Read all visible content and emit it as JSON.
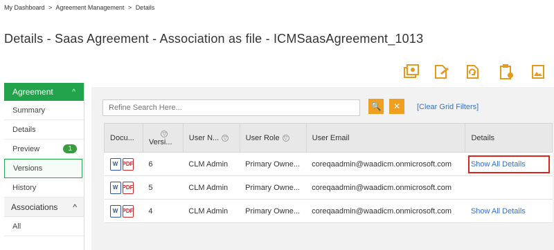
{
  "breadcrumb": [
    "My Dashboard",
    "Agreement Management",
    "Details"
  ],
  "breadcrumb_sep": ">",
  "page_title": "Details - Saas Agreement - Association as file - ICMSaasAgreement_1013",
  "toolbar": {
    "icons": [
      "agreement-copy-icon",
      "edit-document-icon",
      "refresh-document-icon",
      "clipboard-icon",
      "image-document-icon"
    ],
    "accent": "#f0a020"
  },
  "sidebar": {
    "header": "Agreement",
    "header_chevron": "^",
    "items": [
      {
        "label": "Summary"
      },
      {
        "label": "Details"
      },
      {
        "label": "Preview",
        "badge": "1"
      },
      {
        "label": "Versions",
        "selected": true
      },
      {
        "label": "History"
      }
    ],
    "group2": "Associations",
    "group2_chevron": "^",
    "group2_items": [
      {
        "label": "All"
      }
    ]
  },
  "search": {
    "placeholder": "Refine Search Here...",
    "search_icon": "🔍",
    "clear_icon": "✕",
    "clear_link": "[Clear Grid Filters]"
  },
  "grid": {
    "columns": [
      "Docu...",
      "Versi...",
      "User N...",
      "User Role",
      "User Email",
      "Details"
    ],
    "rows": [
      {
        "version": "6",
        "user": "CLM Admin",
        "role": "Primary Owne...",
        "email": "coreqaadmin@waadicm.onmicrosoft.com",
        "details": "Show All Details"
      },
      {
        "version": "5",
        "user": "CLM Admin",
        "role": "Primary Owne...",
        "email": "coreqaadmin@waadicm.onmicrosoft.com",
        "details": ""
      },
      {
        "version": "4",
        "user": "CLM Admin",
        "role": "Primary Owne...",
        "email": "coreqaadmin@waadicm.onmicrosoft.com",
        "details": "Show All Details"
      }
    ],
    "doc_icons": [
      "W",
      "PDF"
    ]
  },
  "colors": {
    "green": "#22a34b",
    "badge": "#3a9b3f",
    "link": "#3a6fbf",
    "highlight": "#d9231f"
  }
}
